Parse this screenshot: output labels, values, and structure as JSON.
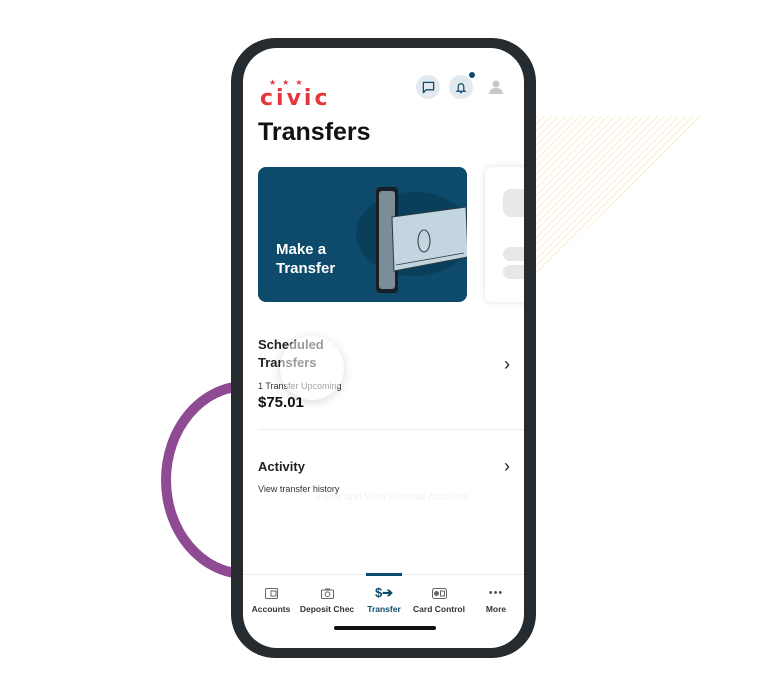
{
  "decor": {
    "ring_color": "#8e4a93",
    "stripe_color": "#f7e6b5"
  },
  "header": {
    "logo": "civic",
    "logo_color": "#e5373b",
    "icons": [
      "chat-icon",
      "bell-icon",
      "profile-icon"
    ]
  },
  "page": {
    "title": "Transfers"
  },
  "cards": [
    {
      "label": "Make a Transfer",
      "color": "#0d4a6b"
    }
  ],
  "scheduled": {
    "title_line1": "Scheduled",
    "title_line2": "Transfers",
    "subtitle": "1 Transfer Upcoming",
    "amount": "$75.01"
  },
  "activity": {
    "title": "Activity",
    "subtitle": "View transfer history"
  },
  "ghost_text": "+ Link and View External Accounts",
  "tabbar": {
    "active": "Transfer",
    "tabs": [
      {
        "label": "Accounts",
        "icon": "wallet-icon"
      },
      {
        "label": "Deposit Chec",
        "icon": "camera-icon"
      },
      {
        "label": "Transfer",
        "icon": "dollar-transfer-icon"
      },
      {
        "label": "Card Control",
        "icon": "card-control-icon"
      },
      {
        "label": "More",
        "icon": "more-icon"
      }
    ]
  }
}
